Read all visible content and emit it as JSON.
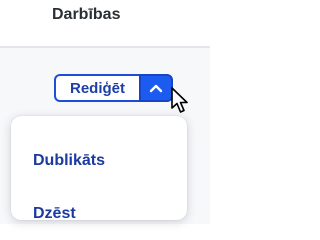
{
  "header": {
    "title": "Darbības"
  },
  "actions": {
    "edit_label": "Rediģēt",
    "toggle_icon": "chevron-up-icon"
  },
  "menu": {
    "items": [
      {
        "label": "Dublikāts"
      },
      {
        "label": "Dzēst"
      }
    ]
  },
  "colors": {
    "accent": "#1c5bf0",
    "text_link": "#1b3aa0",
    "header_text": "#2b2f36"
  }
}
